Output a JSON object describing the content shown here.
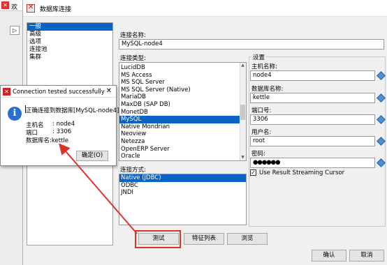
{
  "background_window": {
    "title": "欢",
    "icon": "kettle-app-icon"
  },
  "dialog": {
    "title": "数据库连接",
    "nav": [
      "一般",
      "高级",
      "选项",
      "连接池",
      "集群"
    ],
    "connection_name_label": "连接名称:",
    "connection_name_value": "MySQL-node4",
    "connection_type_label": "连接类型:",
    "connection_types": [
      "LucidDB",
      "MS Access",
      "MS SQL Server",
      "MS SQL Server (Native)",
      "MariaDB",
      "MaxDB (SAP DB)",
      "MonetDB",
      "MySQL",
      "Native Mondrian",
      "Neoview",
      "Netezza",
      "OpenERP Server",
      "Oracle"
    ],
    "selected_connection_type": "MySQL",
    "access_label": "连接方式:",
    "access_methods": [
      "Native (JDBC)",
      "ODBC",
      "JNDI"
    ],
    "selected_access": "Native (JDBC)",
    "settings": {
      "title": "设置",
      "host_label": "主机名称:",
      "host_value": "node4",
      "db_label": "数据库名称:",
      "db_value": "kettle",
      "port_label": "端口号:",
      "port_value": "3306",
      "user_label": "用户名:",
      "user_value": "root",
      "password_label": "密码:",
      "password_value": "●●●●●●",
      "streaming_label": "Use Result Streaming Cursor"
    },
    "buttons": {
      "test": "测试",
      "features": "特征列表",
      "explore": "浏览",
      "ok": "确认",
      "cancel": "取消"
    }
  },
  "popup": {
    "title": "Connection tested successfully",
    "close": "✕",
    "line1": "正确连接到数据库[MySQL-node4]",
    "host_label": "主机名",
    "host_value": ": node4",
    "port_label": "端口",
    "port_value": ": 3306",
    "db_line": "数据库名:kettle",
    "ok_button": "确定(O)"
  },
  "colors": {
    "selection": "#0a64c8",
    "annotation": "#e0302a",
    "info": "#2a6fcf"
  }
}
